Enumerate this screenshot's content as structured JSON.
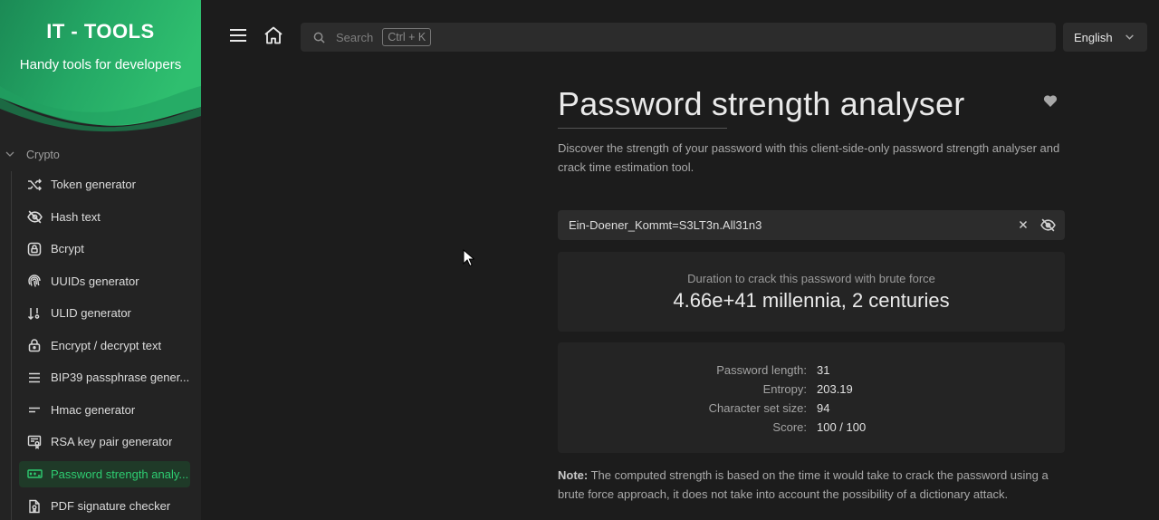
{
  "app": {
    "brand": "IT - TOOLS",
    "tagline": "Handy tools for developers",
    "accent": "#2ecc71"
  },
  "sidebar": {
    "section": "Crypto",
    "items": [
      {
        "label": "Token generator",
        "icon": "shuffle-icon"
      },
      {
        "label": "Hash text",
        "icon": "eye-off-icon"
      },
      {
        "label": "Bcrypt",
        "icon": "lock-square-icon"
      },
      {
        "label": "UUIDs generator",
        "icon": "fingerprint-icon"
      },
      {
        "label": "ULID generator",
        "icon": "sort-arrows-icon"
      },
      {
        "label": "Encrypt / decrypt text",
        "icon": "lock-icon"
      },
      {
        "label": "BIP39 passphrase gener...",
        "icon": "lines-icon"
      },
      {
        "label": "Hmac generator",
        "icon": "short-lines-icon"
      },
      {
        "label": "RSA key pair generator",
        "icon": "certificate-icon"
      },
      {
        "label": "Password strength analy...",
        "icon": "password-icon",
        "active": true
      },
      {
        "label": "PDF signature checker",
        "icon": "file-certificate-icon"
      }
    ]
  },
  "topbar": {
    "search_placeholder": "Search",
    "search_shortcut": "Ctrl + K",
    "language": "English"
  },
  "main": {
    "title": "Password strength analyser",
    "description": "Discover the strength of your password with this client-side-only password strength analyser and crack time estimation tool.",
    "password_value": "Ein-Doener_Kommt=S3LT3n.All31n3",
    "crack_caption": "Duration to crack this password with brute force",
    "crack_duration": "4.66e+41 millennia, 2 centuries",
    "stats": [
      {
        "label": "Password length:",
        "value": "31"
      },
      {
        "label": "Entropy:",
        "value": "203.19"
      },
      {
        "label": "Character set size:",
        "value": "94"
      },
      {
        "label": "Score:",
        "value": "100 / 100"
      }
    ],
    "note_label": "Note:",
    "note_text": " The computed strength is based on the time it would take to crack the password using a brute force approach, it does not take into account the possibility of a dictionary attack."
  }
}
